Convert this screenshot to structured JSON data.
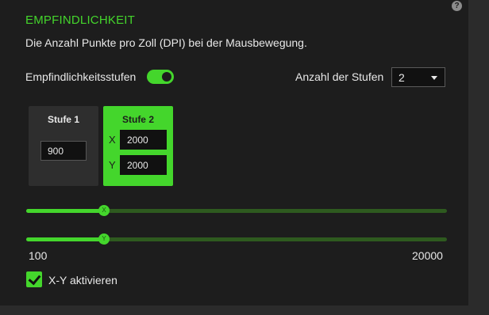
{
  "section": {
    "title": "EMPFINDLICHKEIT",
    "description": "Die Anzahl Punkte pro Zoll (DPI) bei der Mausbewegung.",
    "help_icon": "?"
  },
  "stages_toggle": {
    "label": "Empfindlichkeitsstufen",
    "enabled": true
  },
  "stage_count": {
    "label": "Anzahl der Stufen",
    "value": "2"
  },
  "stages": [
    {
      "title": "Stufe 1",
      "dpi": "900"
    },
    {
      "title": "Stufe 2",
      "x_label": "X",
      "x_dpi": "2000",
      "y_label": "Y",
      "y_dpi": "2000"
    }
  ],
  "sliders": {
    "x_thumb": "X",
    "y_thumb": "Y",
    "min_label": "100",
    "max_label": "20000",
    "x_value": 2000,
    "y_value": 2000,
    "min": 100,
    "max": 20000
  },
  "xy_enable": {
    "label": "X-Y aktivieren",
    "checked": true
  },
  "colors": {
    "accent": "#44d62c",
    "panel": "#1d1d1d",
    "track": "#2e5a1f"
  }
}
